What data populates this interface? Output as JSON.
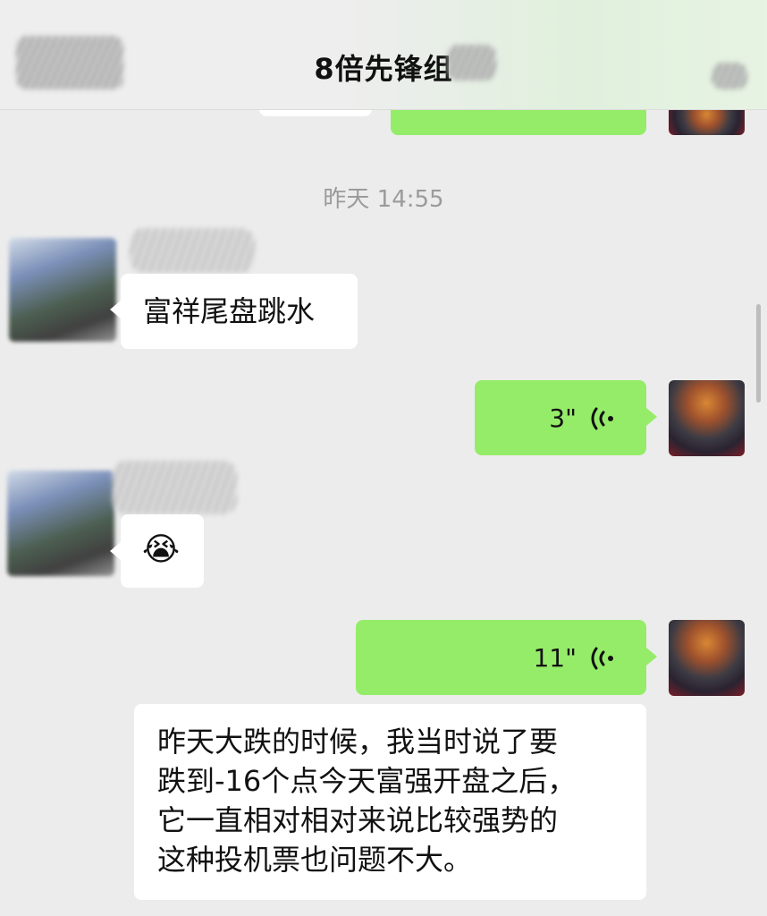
{
  "header": {
    "title": "8倍先锋组"
  },
  "chat": {
    "timestamp": "昨天 14:55",
    "messages": [
      {
        "side": "left",
        "type": "text",
        "text": "富祥尾盘跳水"
      },
      {
        "side": "right",
        "type": "voice",
        "duration": "3\""
      },
      {
        "side": "left",
        "type": "emoji",
        "emoji": "😭"
      },
      {
        "side": "right",
        "type": "voice",
        "duration": "11\""
      },
      {
        "side": "right",
        "type": "text",
        "lines": [
          "昨天大跌的时候，我当时说了要",
          "跌到-16个点今天富强开盘之后，",
          "它一直相对相对来说比较强势的",
          "这种投机票也问题不大。"
        ]
      }
    ]
  },
  "icons": {
    "voice": "voice-wave-icon"
  },
  "colors": {
    "background": "#ececec",
    "bubble_green": "#95ec69",
    "bubble_white": "#ffffff",
    "timestamp": "#9b9b9b"
  }
}
